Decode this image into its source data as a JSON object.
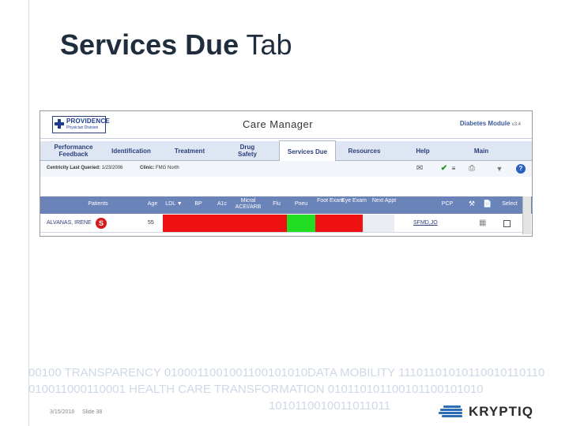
{
  "slide": {
    "title_bold": "Services Due",
    "title_rest": " Tab",
    "date": "3/15/2018",
    "slide_number": "Slide 38",
    "footer_lines": [
      "00100 TRANSPARENCY 0100011001001100101010DATA MOBILITY 11101101010110010110110",
      "010011000110001 HEALTH CARE TRANSFORMATION 010110101100101100101010",
      "1010110010011011011"
    ],
    "brand": "KRYPTIQ"
  },
  "app": {
    "logo_name": "PROVIDENCE",
    "logo_sub": "Physician Division",
    "title": "Care Manager",
    "module": "Diabetes Module",
    "module_version": "v3.4"
  },
  "tabs": [
    {
      "label": "Performance Feedback"
    },
    {
      "label": "Identification"
    },
    {
      "label": "Treatment"
    },
    {
      "label": "Drug Safety"
    },
    {
      "label": "Services Due"
    },
    {
      "label": "Resources"
    },
    {
      "label": "Help"
    },
    {
      "label": "Main"
    }
  ],
  "criteria": {
    "last_queried_label": "Centricity Last Queried:",
    "last_queried_value": "1/23/2006",
    "clinic_label": "Clinic:",
    "clinic_value": "FMG North"
  },
  "table": {
    "columns": [
      "Patients",
      "Age",
      "LDL",
      "BP",
      "A1c",
      "Micral ACEI/ARB",
      "Flu",
      "Pneu",
      "Foot Exam",
      "Eye Exam",
      "Next Appt",
      "PCP",
      "Select"
    ],
    "row": {
      "patient": "ALVANAS, IRENE",
      "badge": "S",
      "age": "55",
      "pcp": "SFMD,JO"
    }
  },
  "colors": {
    "overdue": "#ee1111",
    "current": "#22dd22",
    "header": "#6a83b8"
  }
}
